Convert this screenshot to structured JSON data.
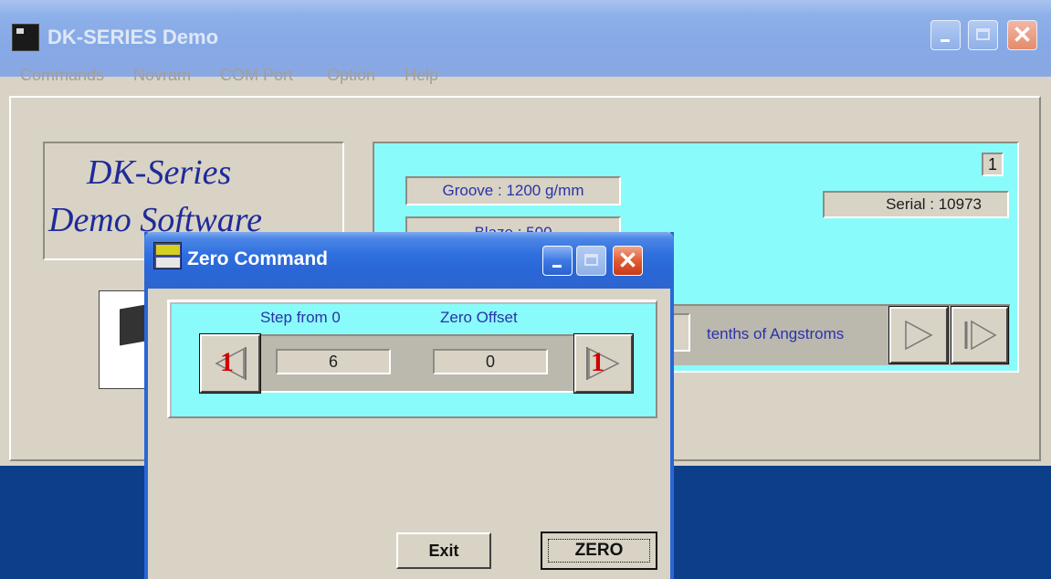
{
  "main_window": {
    "title": "DK-SERIES Demo",
    "menu": [
      "Commands",
      "Novram",
      "COM Port",
      "Option",
      "Help"
    ],
    "logo": {
      "line1": "DK-Series",
      "line2": "Demo Software"
    },
    "groove": "Groove : 1200 g/mm",
    "blaze_partial": "Blaze : 500",
    "serial": "Serial : 10973",
    "counter": "1",
    "units_label": "tenths of Angstroms"
  },
  "dialog": {
    "title": "Zero Command",
    "step_label": "Step from 0",
    "offset_label": "Zero Offset",
    "step_value": "6",
    "offset_value": "0",
    "dec_glyph": "1",
    "inc_glyph": "1",
    "exit_label": "Exit",
    "zero_label": "ZERO"
  }
}
